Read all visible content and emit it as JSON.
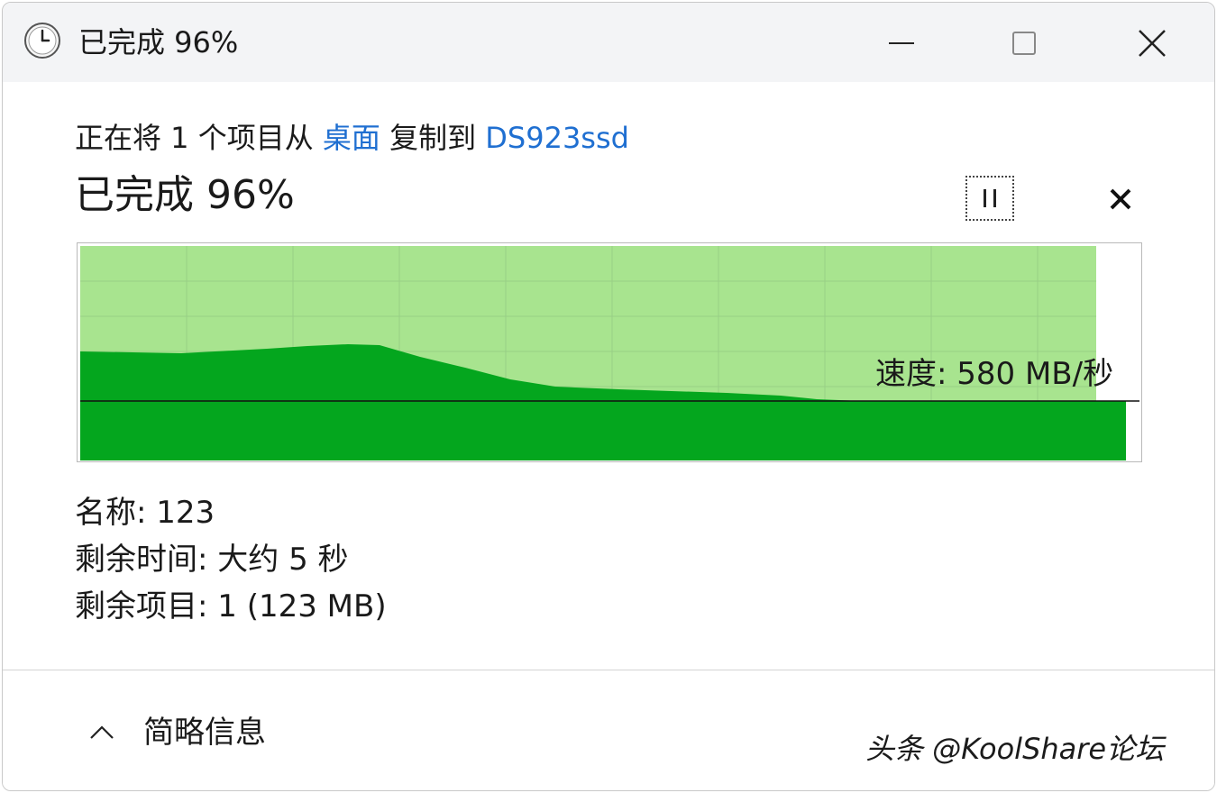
{
  "window": {
    "title": "已完成 96%",
    "icon": "clock-icon",
    "controls": [
      "minimize-icon",
      "maximize-icon",
      "close-icon"
    ]
  },
  "copy": {
    "prefix": "正在将 1 个项目从",
    "source": "桌面",
    "middle": "复制到",
    "destination": "DS923ssd",
    "heading": "已完成 96%",
    "progress_percent": 96
  },
  "actions": {
    "pause_icon": "pause-icon",
    "cancel_icon": "cancel-icon"
  },
  "speed": {
    "label": "速度: 580 MB/秒"
  },
  "details": {
    "name": "名称: 123",
    "time_remaining": "剩余时间: 大约 5 秒",
    "items_remaining": "剩余项目: 1 (123 MB)"
  },
  "footer": {
    "less_details_label": "简略信息",
    "chevron_icon": "chevron-up-icon"
  },
  "watermark": {
    "text": "头条 @KoolShare论坛"
  },
  "colors": {
    "progress_fill": "#a8e48f",
    "speed_fill": "#04a61e",
    "grid_line": "#98cf85",
    "link": "#1f6fd1"
  }
}
